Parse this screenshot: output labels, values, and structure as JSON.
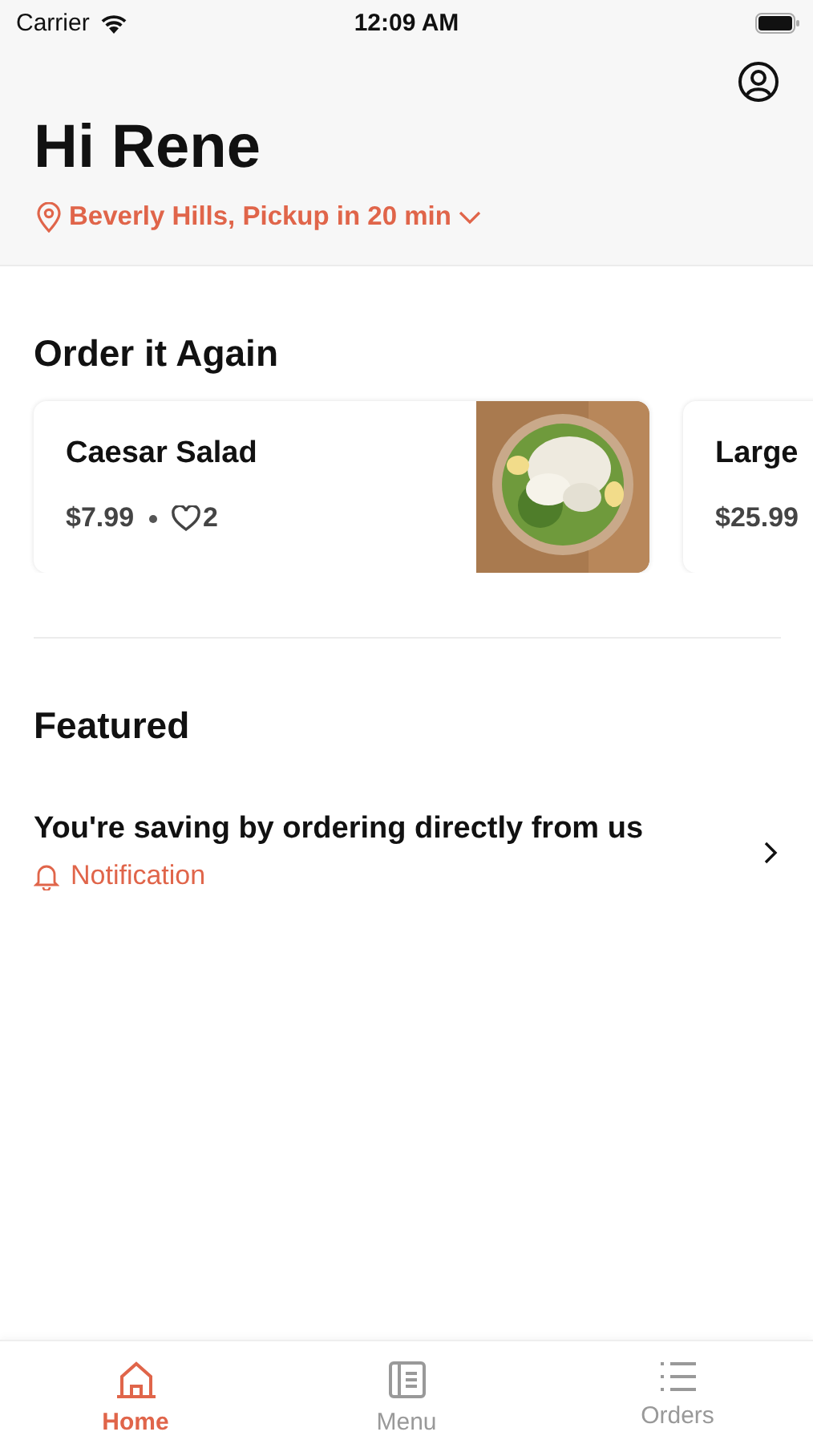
{
  "status_bar": {
    "carrier": "Carrier",
    "time": "12:09 AM"
  },
  "header": {
    "greeting": "Hi Rene",
    "location": "Beverly Hills, Pickup in 20 min"
  },
  "order_again": {
    "title": "Order it Again",
    "items": [
      {
        "name": "Caesar Salad",
        "price": "$7.99",
        "likes": "2"
      },
      {
        "name": "Large",
        "price": "$25.99"
      }
    ]
  },
  "featured": {
    "title": "Featured",
    "items": [
      {
        "title": "You're saving by ordering directly from us",
        "tag": "Notification"
      }
    ]
  },
  "tabs": [
    {
      "label": "Home",
      "kind": "home",
      "selected": true
    },
    {
      "label": "Menu",
      "kind": "menu",
      "selected": false
    },
    {
      "label": "Orders",
      "kind": "orders",
      "selected": false
    }
  ]
}
